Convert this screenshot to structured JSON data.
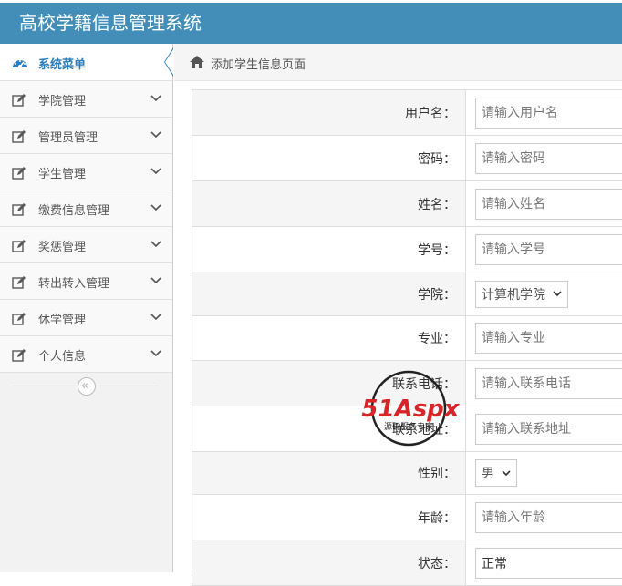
{
  "header": {
    "title": "高校学籍信息管理系统"
  },
  "sidebar": {
    "menu_title": "系统菜单",
    "items": [
      {
        "label": "学院管理"
      },
      {
        "label": "管理员管理"
      },
      {
        "label": "学生管理"
      },
      {
        "label": "缴费信息管理"
      },
      {
        "label": "奖惩管理"
      },
      {
        "label": "转出转入管理"
      },
      {
        "label": "休学管理"
      },
      {
        "label": "个人信息"
      }
    ],
    "collapse_glyph": "«"
  },
  "breadcrumb": {
    "label": "添加学生信息页面"
  },
  "form": {
    "username": {
      "label": "用户名：",
      "placeholder": "请输入用户名"
    },
    "password": {
      "label": "密码：",
      "placeholder": "请输入密码"
    },
    "name": {
      "label": "姓名：",
      "placeholder": "请输入姓名"
    },
    "student_no": {
      "label": "学号：",
      "placeholder": "请输入学号"
    },
    "college": {
      "label": "学院：",
      "value": "计算机学院"
    },
    "major": {
      "label": "专业：",
      "placeholder": "请输入专业"
    },
    "phone": {
      "label": "联系电话：",
      "placeholder": "请输入联系电话"
    },
    "address": {
      "label": "联系地址：",
      "placeholder": "请输入联系地址"
    },
    "gender": {
      "label": "性别：",
      "value": "男"
    },
    "age": {
      "label": "年龄：",
      "placeholder": "请输入年龄"
    },
    "status": {
      "label": "状态：",
      "value": "正常"
    }
  },
  "watermark": {
    "brand": "51Aspx",
    "tagline": "源码服务专家"
  },
  "colors": {
    "header": "#438eb9",
    "accent": "#2b7dbc",
    "watermark_red": "#d9252a",
    "watermark_green": "#2e9c3c"
  }
}
